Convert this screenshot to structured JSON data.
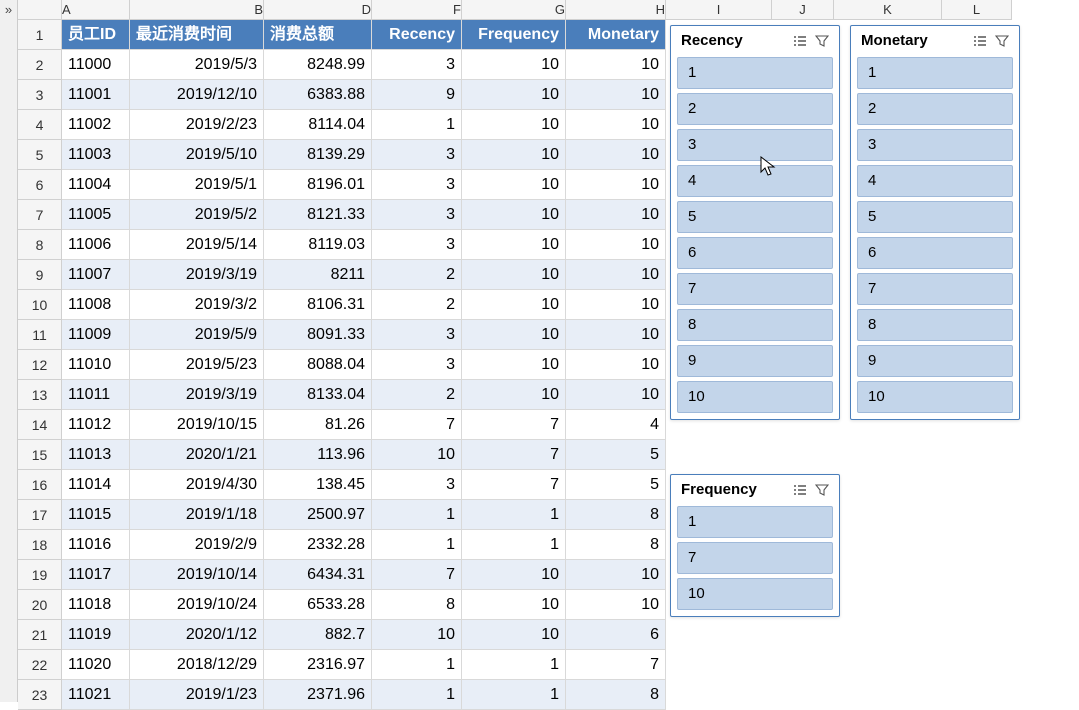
{
  "collapse_glyph": "»",
  "col_letters": [
    "A",
    "B",
    "D",
    "F",
    "G",
    "H",
    "I",
    "J",
    "K",
    "L"
  ],
  "headers": {
    "A": "员工ID",
    "B": "最近消费时间",
    "D": "消费总额",
    "F": "Recency",
    "G": "Frequency",
    "H": "Monetary"
  },
  "rows": [
    {
      "n": 2,
      "A": "11000",
      "B": "2019/5/3",
      "D": "8248.99",
      "F": "3",
      "G": "10",
      "H": "10"
    },
    {
      "n": 3,
      "A": "11001",
      "B": "2019/12/10",
      "D": "6383.88",
      "F": "9",
      "G": "10",
      "H": "10"
    },
    {
      "n": 4,
      "A": "11002",
      "B": "2019/2/23",
      "D": "8114.04",
      "F": "1",
      "G": "10",
      "H": "10"
    },
    {
      "n": 5,
      "A": "11003",
      "B": "2019/5/10",
      "D": "8139.29",
      "F": "3",
      "G": "10",
      "H": "10"
    },
    {
      "n": 6,
      "A": "11004",
      "B": "2019/5/1",
      "D": "8196.01",
      "F": "3",
      "G": "10",
      "H": "10"
    },
    {
      "n": 7,
      "A": "11005",
      "B": "2019/5/2",
      "D": "8121.33",
      "F": "3",
      "G": "10",
      "H": "10"
    },
    {
      "n": 8,
      "A": "11006",
      "B": "2019/5/14",
      "D": "8119.03",
      "F": "3",
      "G": "10",
      "H": "10"
    },
    {
      "n": 9,
      "A": "11007",
      "B": "2019/3/19",
      "D": "8211",
      "F": "2",
      "G": "10",
      "H": "10"
    },
    {
      "n": 10,
      "A": "11008",
      "B": "2019/3/2",
      "D": "8106.31",
      "F": "2",
      "G": "10",
      "H": "10"
    },
    {
      "n": 11,
      "A": "11009",
      "B": "2019/5/9",
      "D": "8091.33",
      "F": "3",
      "G": "10",
      "H": "10"
    },
    {
      "n": 12,
      "A": "11010",
      "B": "2019/5/23",
      "D": "8088.04",
      "F": "3",
      "G": "10",
      "H": "10"
    },
    {
      "n": 13,
      "A": "11011",
      "B": "2019/3/19",
      "D": "8133.04",
      "F": "2",
      "G": "10",
      "H": "10"
    },
    {
      "n": 14,
      "A": "11012",
      "B": "2019/10/15",
      "D": "81.26",
      "F": "7",
      "G": "7",
      "H": "4"
    },
    {
      "n": 15,
      "A": "11013",
      "B": "2020/1/21",
      "D": "113.96",
      "F": "10",
      "G": "7",
      "H": "5"
    },
    {
      "n": 16,
      "A": "11014",
      "B": "2019/4/30",
      "D": "138.45",
      "F": "3",
      "G": "7",
      "H": "5"
    },
    {
      "n": 17,
      "A": "11015",
      "B": "2019/1/18",
      "D": "2500.97",
      "F": "1",
      "G": "1",
      "H": "8"
    },
    {
      "n": 18,
      "A": "11016",
      "B": "2019/2/9",
      "D": "2332.28",
      "F": "1",
      "G": "1",
      "H": "8"
    },
    {
      "n": 19,
      "A": "11017",
      "B": "2019/10/14",
      "D": "6434.31",
      "F": "7",
      "G": "10",
      "H": "10"
    },
    {
      "n": 20,
      "A": "11018",
      "B": "2019/10/24",
      "D": "6533.28",
      "F": "8",
      "G": "10",
      "H": "10"
    },
    {
      "n": 21,
      "A": "11019",
      "B": "2020/1/12",
      "D": "882.7",
      "F": "10",
      "G": "10",
      "H": "6"
    },
    {
      "n": 22,
      "A": "11020",
      "B": "2018/12/29",
      "D": "2316.97",
      "F": "1",
      "G": "1",
      "H": "7"
    },
    {
      "n": 23,
      "A": "11021",
      "B": "2019/1/23",
      "D": "2371.96",
      "F": "1",
      "G": "1",
      "H": "8"
    }
  ],
  "slicers": {
    "recency": {
      "title": "Recency",
      "items": [
        "1",
        "2",
        "3",
        "4",
        "5",
        "6",
        "7",
        "8",
        "9",
        "10"
      ]
    },
    "monetary": {
      "title": "Monetary",
      "items": [
        "1",
        "2",
        "3",
        "4",
        "5",
        "6",
        "7",
        "8",
        "9",
        "10"
      ]
    },
    "frequency": {
      "title": "Frequency",
      "items": [
        "1",
        "7",
        "10"
      ]
    }
  },
  "chart_data": {
    "type": "table",
    "columns": [
      "员工ID",
      "最近消费时间",
      "消费总额",
      "Recency",
      "Frequency",
      "Monetary"
    ],
    "rows": [
      [
        "11000",
        "2019/5/3",
        8248.99,
        3,
        10,
        10
      ],
      [
        "11001",
        "2019/12/10",
        6383.88,
        9,
        10,
        10
      ],
      [
        "11002",
        "2019/2/23",
        8114.04,
        1,
        10,
        10
      ],
      [
        "11003",
        "2019/5/10",
        8139.29,
        3,
        10,
        10
      ],
      [
        "11004",
        "2019/5/1",
        8196.01,
        3,
        10,
        10
      ],
      [
        "11005",
        "2019/5/2",
        8121.33,
        3,
        10,
        10
      ],
      [
        "11006",
        "2019/5/14",
        8119.03,
        3,
        10,
        10
      ],
      [
        "11007",
        "2019/3/19",
        8211,
        2,
        10,
        10
      ],
      [
        "11008",
        "2019/3/2",
        8106.31,
        2,
        10,
        10
      ],
      [
        "11009",
        "2019/5/9",
        8091.33,
        3,
        10,
        10
      ],
      [
        "11010",
        "2019/5/23",
        8088.04,
        3,
        10,
        10
      ],
      [
        "11011",
        "2019/3/19",
        8133.04,
        2,
        10,
        10
      ],
      [
        "11012",
        "2019/10/15",
        81.26,
        7,
        7,
        4
      ],
      [
        "11013",
        "2020/1/21",
        113.96,
        10,
        7,
        5
      ],
      [
        "11014",
        "2019/4/30",
        138.45,
        3,
        7,
        5
      ],
      [
        "11015",
        "2019/1/18",
        2500.97,
        1,
        1,
        8
      ],
      [
        "11016",
        "2019/2/9",
        2332.28,
        1,
        1,
        8
      ],
      [
        "11017",
        "2019/10/14",
        6434.31,
        7,
        10,
        10
      ],
      [
        "11018",
        "2019/10/24",
        6533.28,
        8,
        10,
        10
      ],
      [
        "11019",
        "2020/1/12",
        882.7,
        10,
        10,
        6
      ],
      [
        "11020",
        "2018/12/29",
        2316.97,
        1,
        1,
        7
      ],
      [
        "11021",
        "2019/1/23",
        2371.96,
        1,
        1,
        8
      ]
    ]
  }
}
